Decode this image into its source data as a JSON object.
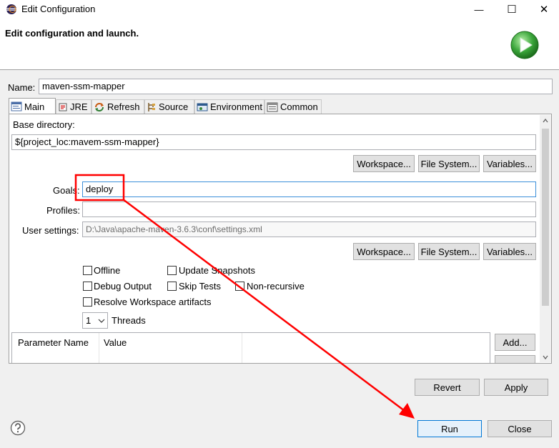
{
  "window": {
    "title": "Edit Configuration",
    "minimize_glyph": "—",
    "maximize_glyph": "☐",
    "close_glyph": "✕"
  },
  "banner": {
    "title": "Edit configuration and launch."
  },
  "name": {
    "label": "Name:",
    "value": "maven-ssm-mapper"
  },
  "tabs": [
    {
      "label": "Main",
      "icon": "main-tab-icon"
    },
    {
      "label": "JRE",
      "icon": "jre-icon"
    },
    {
      "label": "Refresh",
      "icon": "refresh-icon"
    },
    {
      "label": "Source",
      "icon": "source-icon"
    },
    {
      "label": "Environment",
      "icon": "environment-icon"
    },
    {
      "label": "Common",
      "icon": "common-icon"
    }
  ],
  "main": {
    "base_dir_label": "Base directory:",
    "base_dir_value": "${project_loc:mavem-ssm-mapper}",
    "buttons1": {
      "workspace": "Workspace...",
      "filesystem": "File System...",
      "variables": "Variables..."
    },
    "goals_label": "Goals:",
    "goals_value": "deploy",
    "profiles_label": "Profiles:",
    "profiles_value": "",
    "user_settings_label": "User settings:",
    "user_settings_value": "D:\\Java\\apache-maven-3.6.3\\conf\\settings.xml",
    "buttons2": {
      "workspace": "Workspace...",
      "filesystem": "File System...",
      "variables": "Variables..."
    },
    "checkboxes": {
      "offline": "Offline",
      "update_snapshots": "Update Snapshots",
      "debug_output": "Debug Output",
      "skip_tests": "Skip Tests",
      "non_recursive": "Non-recursive",
      "resolve_workspace": "Resolve Workspace artifacts"
    },
    "threads_value": "1",
    "threads_label": "Threads",
    "param_table": {
      "col_name": "Parameter Name",
      "col_value": "Value"
    },
    "add_button": "Add..."
  },
  "actions": {
    "revert": "Revert",
    "apply": "Apply",
    "run": "Run",
    "close": "Close"
  },
  "colors": {
    "highlight": "#ff0000",
    "focus": "#3c8fd9",
    "run_icon": "#3aa53a"
  }
}
